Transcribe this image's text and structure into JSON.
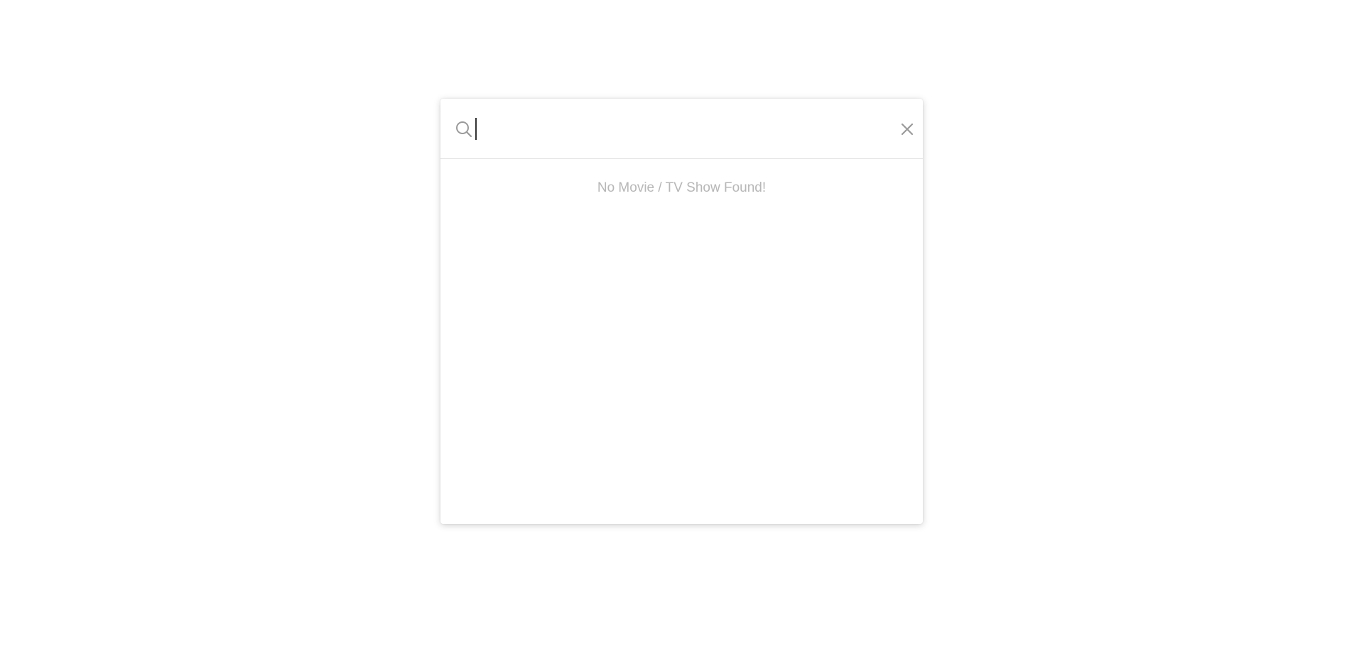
{
  "search": {
    "value": "",
    "placeholder": "",
    "search_icon": "search-icon",
    "close_icon": "close-icon"
  },
  "results": {
    "empty_message": "No Movie / TV Show Found!"
  },
  "colors": {
    "background": "#ffffff",
    "icon": "#9a9a9a",
    "empty_text": "#b7b7b7",
    "divider": "#e3e3e3"
  }
}
